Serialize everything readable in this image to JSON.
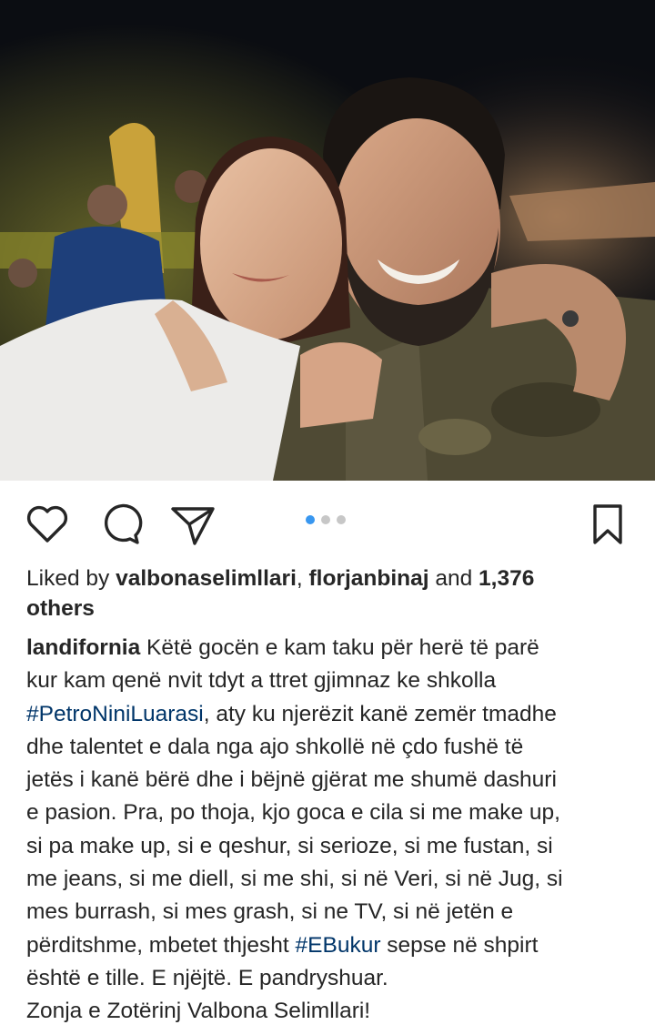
{
  "post": {
    "photo_alt": "selfie photo",
    "carousel": {
      "count": 3,
      "active": 0
    }
  },
  "actions": {
    "like_icon": "heart-icon",
    "comment_icon": "comment-icon",
    "share_icon": "paper-plane-icon",
    "save_icon": "bookmark-icon",
    "accent_color": "#3897f0",
    "tag_color": "#003569"
  },
  "likes": {
    "prefix": "Liked by ",
    "user1": "valbonaselimllari",
    "sep": ", ",
    "user2": "florjanbinaj",
    "and": " and ",
    "count": "1,376",
    "others": "others"
  },
  "caption": {
    "username": "landifornia",
    "line1_text": " Këtë gocën e kam taku për herë të parë",
    "line2": "kur kam qenë nvit tdyt a ttret gjimnaz ke shkolla",
    "hashtag1": "#PetroNiniLuarasi",
    "line3_rest": ", aty ku njerëzit kanë zemër tmadhe",
    "line4": "dhe talentet e dala nga ajo shkollë në çdo fushë të",
    "line5": "jetës i kanë bërë dhe i bëjnë gjërat me shumë dashuri",
    "line6": "e pasion. Pra, po thoja, kjo goca e cila si me make up,",
    "line7": "si pa make up, si e qeshur, si serioze, si me fustan, si",
    "line8": "me jeans, si me diell, si me shi, si në Veri, si në Jug, si",
    "line9": "mes burrash, si mes grash, si ne TV, si në jetën e",
    "line10_start": "përditshme, mbetet thjesht ",
    "hashtag2": "#EBukur",
    "line10_end": " sepse në shpirt",
    "line11": "është e tille. E njëjtë. E pandryshuar.",
    "line12": "Zonja e Zotërinj Valbona Selimllari!"
  }
}
